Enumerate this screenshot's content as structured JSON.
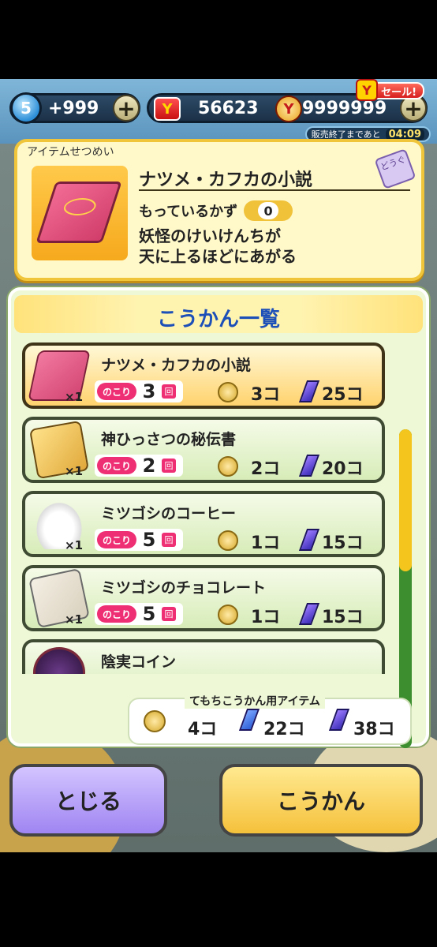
{
  "currency": {
    "spirit_level": "5",
    "spirit_value": "+999",
    "ymoney_value": "56623",
    "ycoin_value": "9999999",
    "sale_label": "セール!",
    "timer_label": "販売終了まであと",
    "timer_value": "04:09"
  },
  "description": {
    "panel_title": "アイテムせつめい",
    "item_name": "ナツメ・カフカの小説",
    "category_tag": "どうぐ",
    "have_label": "もっているかず",
    "have_count": "0",
    "flavor_line1": "妖怪のけいけんちが",
    "flavor_line2": "天に上るほどにあがる"
  },
  "exchange_list": {
    "title": "こうかん一覧",
    "remain_label": "のこり",
    "times_unit": "回",
    "items": [
      {
        "name": "ナツメ・カフカの小説",
        "qty": "×1",
        "remain": "3",
        "coin_cost": "3コ",
        "crystal_cost": "25コ"
      },
      {
        "name": "神ひっさつの秘伝書",
        "qty": "×1",
        "remain": "2",
        "coin_cost": "2コ",
        "crystal_cost": "20コ"
      },
      {
        "name": "ミツゴシのコーヒー",
        "qty": "×1",
        "remain": "5",
        "coin_cost": "1コ",
        "crystal_cost": "15コ"
      },
      {
        "name": "ミツゴシのチョコレート",
        "qty": "×1",
        "remain": "5",
        "coin_cost": "1コ",
        "crystal_cost": "15コ"
      },
      {
        "name": "陰実コイン"
      }
    ]
  },
  "owned": {
    "label": "てもちこうかん用アイテム",
    "coin": "4コ",
    "blue_crystal": "22コ",
    "purple_crystal": "38コ"
  },
  "buttons": {
    "close": "とじる",
    "exchange": "こうかん"
  },
  "colors": {
    "accent_pink": "#ef2f74",
    "title_blue": "#1c4fb8",
    "selected_row": "#ffd36e"
  }
}
